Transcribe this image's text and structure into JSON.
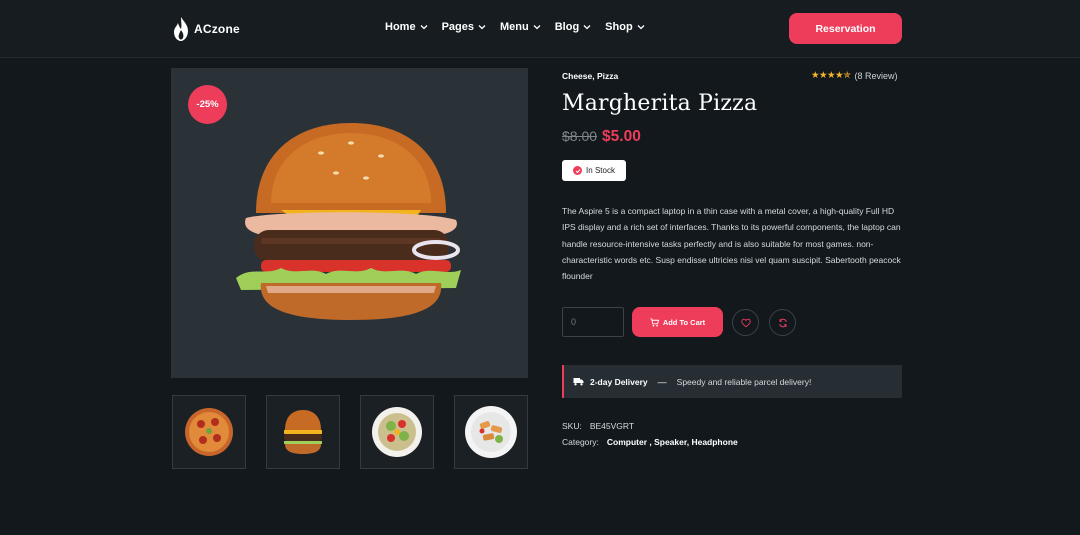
{
  "brand": {
    "name": "ACzone"
  },
  "nav": [
    {
      "label": "Home"
    },
    {
      "label": "Pages"
    },
    {
      "label": "Menu"
    },
    {
      "label": "Blog"
    },
    {
      "label": "Shop"
    }
  ],
  "header": {
    "reservation_label": "Reservation"
  },
  "product": {
    "discount": "-25%",
    "categories": "Cheese, Pizza",
    "rating": 4.5,
    "review_count": "(8 Review)",
    "title": "Margherita Pizza",
    "old_price": "$8.00",
    "new_price": "$5.00",
    "stock": "In Stock",
    "description": "The Aspire 5 is a compact laptop in a thin case with a metal cover, a high-quality Full HD IPS display and a rich set of interfaces. Thanks to its powerful components, the laptop can handle resource-intensive tasks perfectly and is also suitable for most games. non-characteristic words etc. Susp endisse ultricies nisi vel quam suscipit. Sabertooth peacock flounder",
    "quantity_placeholder": "0",
    "add_to_cart_label": "Add To Cart"
  },
  "thumbnails": [
    {
      "icon": "pizza-thumbnail"
    },
    {
      "icon": "burger-thumbnail"
    },
    {
      "icon": "salad-thumbnail"
    },
    {
      "icon": "plate-thumbnail"
    }
  ],
  "delivery": {
    "title": "2-day Delivery",
    "dash": "—",
    "text": "Speedy and reliable parcel delivery!"
  },
  "meta": {
    "sku_label": "SKU:",
    "sku_value": "BE45VGRT",
    "category_label": "Category:",
    "category_links": [
      "Computer",
      "Speaker",
      "Headphone"
    ]
  },
  "colors": {
    "accent": "#ee3d5b",
    "background": "#12181c",
    "star": "#f7b52c"
  }
}
